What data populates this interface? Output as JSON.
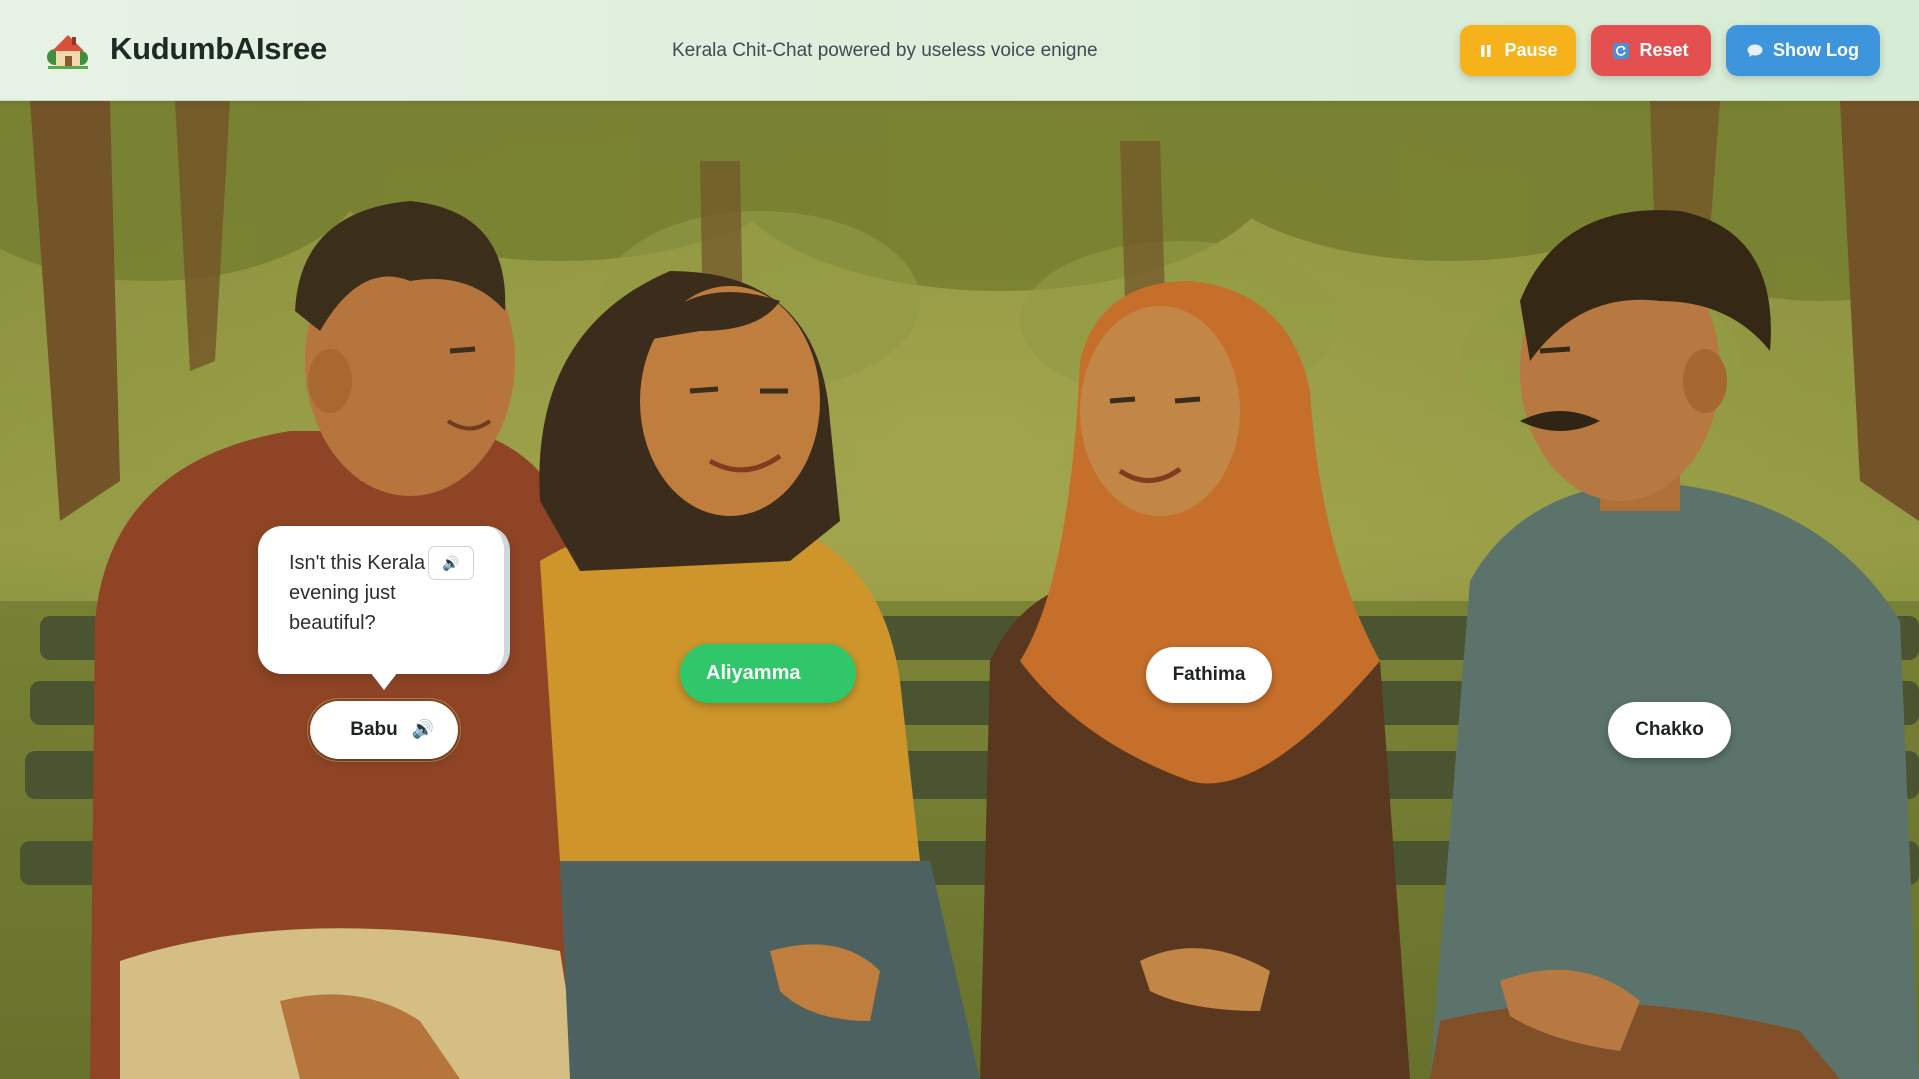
{
  "header": {
    "app_name": "KudumbAIsree",
    "tagline": "Kerala Chit-Chat powered by useless voice enigne",
    "logo_icon": "house-tree-icon",
    "buttons": {
      "pause_label": "Pause",
      "reset_label": "Reset",
      "log_label": "Show Log"
    }
  },
  "characters": [
    {
      "name": "Babu",
      "active": false,
      "speaking": true
    },
    {
      "name": "Aliyamma",
      "active": true,
      "speaking": false
    },
    {
      "name": "Fathima",
      "active": false,
      "speaking": false
    },
    {
      "name": "Chakko",
      "active": false,
      "speaking": false
    }
  ],
  "speech_bubble": {
    "speaker": "Babu",
    "text": "Isn't this Kerala evening just beautiful?"
  },
  "colors": {
    "pause": "#f6b21a",
    "reset": "#e4504f",
    "show_log": "#3d95dc",
    "active_chip": "#2fc76a"
  }
}
